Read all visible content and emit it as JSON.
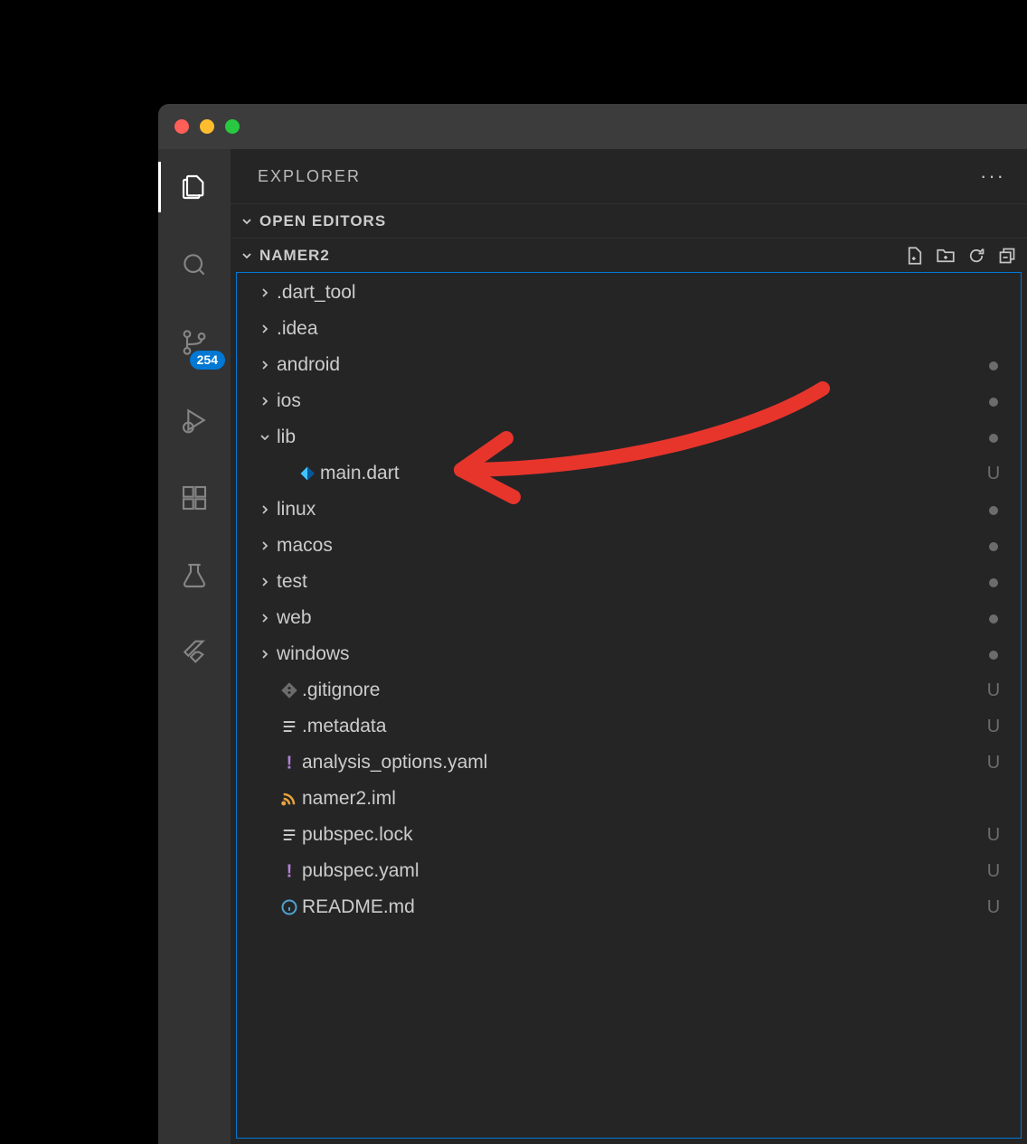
{
  "explorer": {
    "title": "EXPLORER"
  },
  "openEditors": {
    "label": "OPEN EDITORS"
  },
  "project": {
    "name": "NAMER2"
  },
  "sourceControlBadge": "254",
  "tree": [
    {
      "type": "folder",
      "name": ".dart_tool",
      "depth": 0,
      "expanded": false,
      "status": ""
    },
    {
      "type": "folder",
      "name": ".idea",
      "depth": 0,
      "expanded": false,
      "status": ""
    },
    {
      "type": "folder",
      "name": "android",
      "depth": 0,
      "expanded": false,
      "status": "dot"
    },
    {
      "type": "folder",
      "name": "ios",
      "depth": 0,
      "expanded": false,
      "status": "dot"
    },
    {
      "type": "folder",
      "name": "lib",
      "depth": 0,
      "expanded": true,
      "status": "dot"
    },
    {
      "type": "file",
      "name": "main.dart",
      "depth": 1,
      "icon": "dart",
      "status": "U"
    },
    {
      "type": "folder",
      "name": "linux",
      "depth": 0,
      "expanded": false,
      "status": "dot"
    },
    {
      "type": "folder",
      "name": "macos",
      "depth": 0,
      "expanded": false,
      "status": "dot"
    },
    {
      "type": "folder",
      "name": "test",
      "depth": 0,
      "expanded": false,
      "status": "dot"
    },
    {
      "type": "folder",
      "name": "web",
      "depth": 0,
      "expanded": false,
      "status": "dot"
    },
    {
      "type": "folder",
      "name": "windows",
      "depth": 0,
      "expanded": false,
      "status": "dot"
    },
    {
      "type": "file",
      "name": ".gitignore",
      "depth": 0,
      "icon": "git",
      "status": "U"
    },
    {
      "type": "file",
      "name": ".metadata",
      "depth": 0,
      "icon": "lines",
      "status": "U"
    },
    {
      "type": "file",
      "name": "analysis_options.yaml",
      "depth": 0,
      "icon": "yaml",
      "status": "U"
    },
    {
      "type": "file",
      "name": "namer2.iml",
      "depth": 0,
      "icon": "rss",
      "status": ""
    },
    {
      "type": "file",
      "name": "pubspec.lock",
      "depth": 0,
      "icon": "lines",
      "status": "U"
    },
    {
      "type": "file",
      "name": "pubspec.yaml",
      "depth": 0,
      "icon": "yaml",
      "status": "U"
    },
    {
      "type": "file",
      "name": "README.md",
      "depth": 0,
      "icon": "info",
      "status": "U"
    }
  ]
}
